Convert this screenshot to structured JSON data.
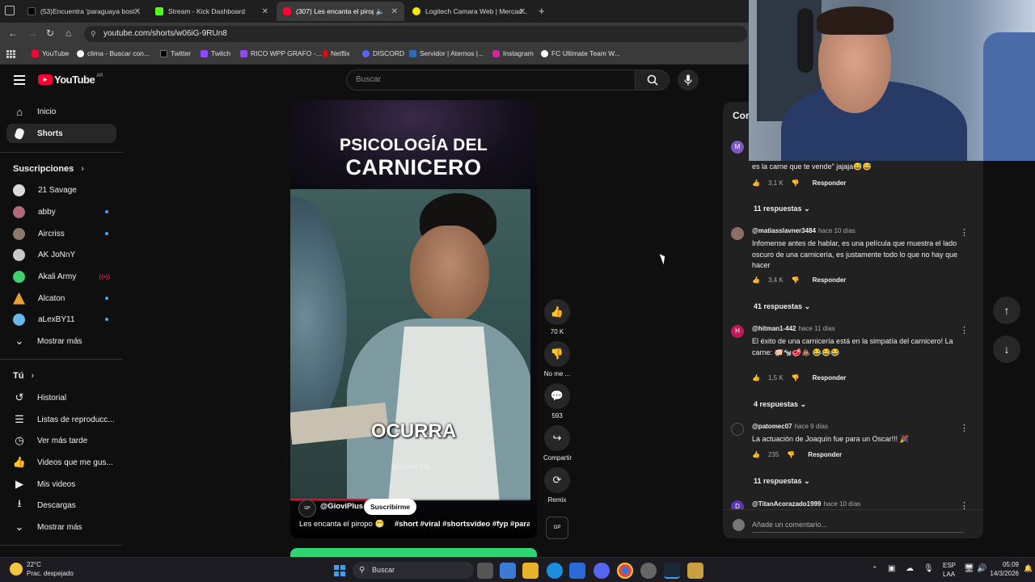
{
  "tabs": [
    {
      "title": "(53)Encuentra 'paraguaya bost...",
      "color": "#3a3a3a"
    },
    {
      "title": "Stream - Kick Dashboard",
      "color": "#53fc18"
    },
    {
      "title": "(307) Les encanta el piropo",
      "color": "#ff0033"
    },
    {
      "title": "Logitech Camara Web | Mercad...",
      "color": "#ffe600"
    }
  ],
  "url": "youtube.com/shorts/w06iG-9RUn8",
  "bookmarks": [
    "YouTube",
    "clima - Buscar con...",
    "Twitter",
    "Twitch",
    "RICO WPP GRAFO -...",
    "Netflix",
    "DISCORD",
    "Servidor | Aternos |...",
    "Instagram",
    "FC Ultimate Team W..."
  ],
  "youtube": {
    "logo": "YouTube",
    "region": "AR",
    "search_placeholder": "Buscar"
  },
  "sidebar": {
    "main": [
      {
        "label": "Inicio",
        "icon": "home-icon"
      },
      {
        "label": "Shorts",
        "icon": "shorts-icon"
      }
    ],
    "subs_title": "Suscripciones",
    "subs": [
      {
        "label": "21 Savage",
        "color": "#d9d9d9",
        "live": false
      },
      {
        "label": "abby",
        "color": "#b06a7a",
        "live": true
      },
      {
        "label": "Aircriss",
        "color": "#8a7a6a",
        "live": true
      },
      {
        "label": "AK JoNnY",
        "color": "#c8c8c8",
        "live": false
      },
      {
        "label": "Akali Army",
        "color": "#3fcf6f",
        "live": false
      },
      {
        "label": "Alcaton",
        "color": "#e8a030",
        "live": true
      },
      {
        "label": "aLexBY11",
        "color": "#6ab8e8",
        "live": true
      }
    ],
    "subs_more": "Mostrar más",
    "you_title": "Tú",
    "you": [
      {
        "label": "Historial",
        "icon": "history-icon"
      },
      {
        "label": "Listas de reproducc...",
        "icon": "playlists-icon"
      },
      {
        "label": "Ver más tarde",
        "icon": "watch-later-icon"
      },
      {
        "label": "Videos que me gus...",
        "icon": "liked-icon"
      },
      {
        "label": "Mis videos",
        "icon": "my-videos-icon"
      },
      {
        "label": "Descargas",
        "icon": "downloads-icon"
      },
      {
        "label": "Mostrar más",
        "icon": "chevron-down-icon"
      }
    ]
  },
  "short": {
    "overlay_title_1": "PSICOLOGÍA DEL",
    "overlay_title_2": "CARNICERO",
    "caption": "OCURRA",
    "watermark": "@GioviPlus",
    "channel": "@GioviPlus",
    "subscribe": "Suscribirme",
    "description": "Les encanta el piropo 😁",
    "hashtags": "#short #viral #shortsvideo #fyp #parat..."
  },
  "actions": {
    "likes": "70 K",
    "dislike": "No me ...",
    "comments": "593",
    "share": "Compartir",
    "remix": "Remix"
  },
  "comments_panel": {
    "title": "Comentarios",
    "items": [
      {
        "author": "",
        "time": "",
        "avatar": "M",
        "avatar_color": "#7e57c2",
        "text": "es la carne que te vende\" jajaja😅😅",
        "likes": "3,1 K",
        "reply": "Responder",
        "replies": "11 respuestas"
      },
      {
        "author": "@matiasslavner3484",
        "time": "hace 10 días",
        "avatar": "",
        "avatar_color": "#8d6e63",
        "text": "Infomense antes de hablar, es una película que muestra el lado oscuro de una carnicería, es justamente todo lo que no hay que hacer",
        "likes": "3,4 K",
        "reply": "Responder",
        "replies": "41 respuestas"
      },
      {
        "author": "@hitman1-442",
        "time": "hace 11 días",
        "avatar": "H",
        "avatar_color": "#c2185b",
        "text": "El éxito de una carnicería está en la simpatía del carnicero! La carne: 🐖🐄🥩💩 😂😂😂",
        "likes": "1,5 K",
        "reply": "Responder",
        "replies": "4 respuestas"
      },
      {
        "author": "@patomec07",
        "time": "hace 9 días",
        "avatar": "",
        "avatar_color": "#222222",
        "text": "La actuación de Joaquín fue para un Oscar!!! 🎉",
        "likes": "235",
        "reply": "Responder",
        "replies": "11 respuestas"
      },
      {
        "author": "@TitanAcorazado1999",
        "time": "hace 10 días",
        "avatar": "D",
        "avatar_color": "#5e35b1",
        "text": "",
        "likes": "",
        "reply": "",
        "replies": ""
      }
    ],
    "add_placeholder": "Añade un comentario..."
  },
  "taskbar": {
    "weather_temp": "22°C",
    "weather_desc": "Prac. despejado",
    "search": "Buscar",
    "lang_1": "ESP",
    "lang_2": "LAA",
    "time": "05:09",
    "date": "14/3/2026"
  }
}
